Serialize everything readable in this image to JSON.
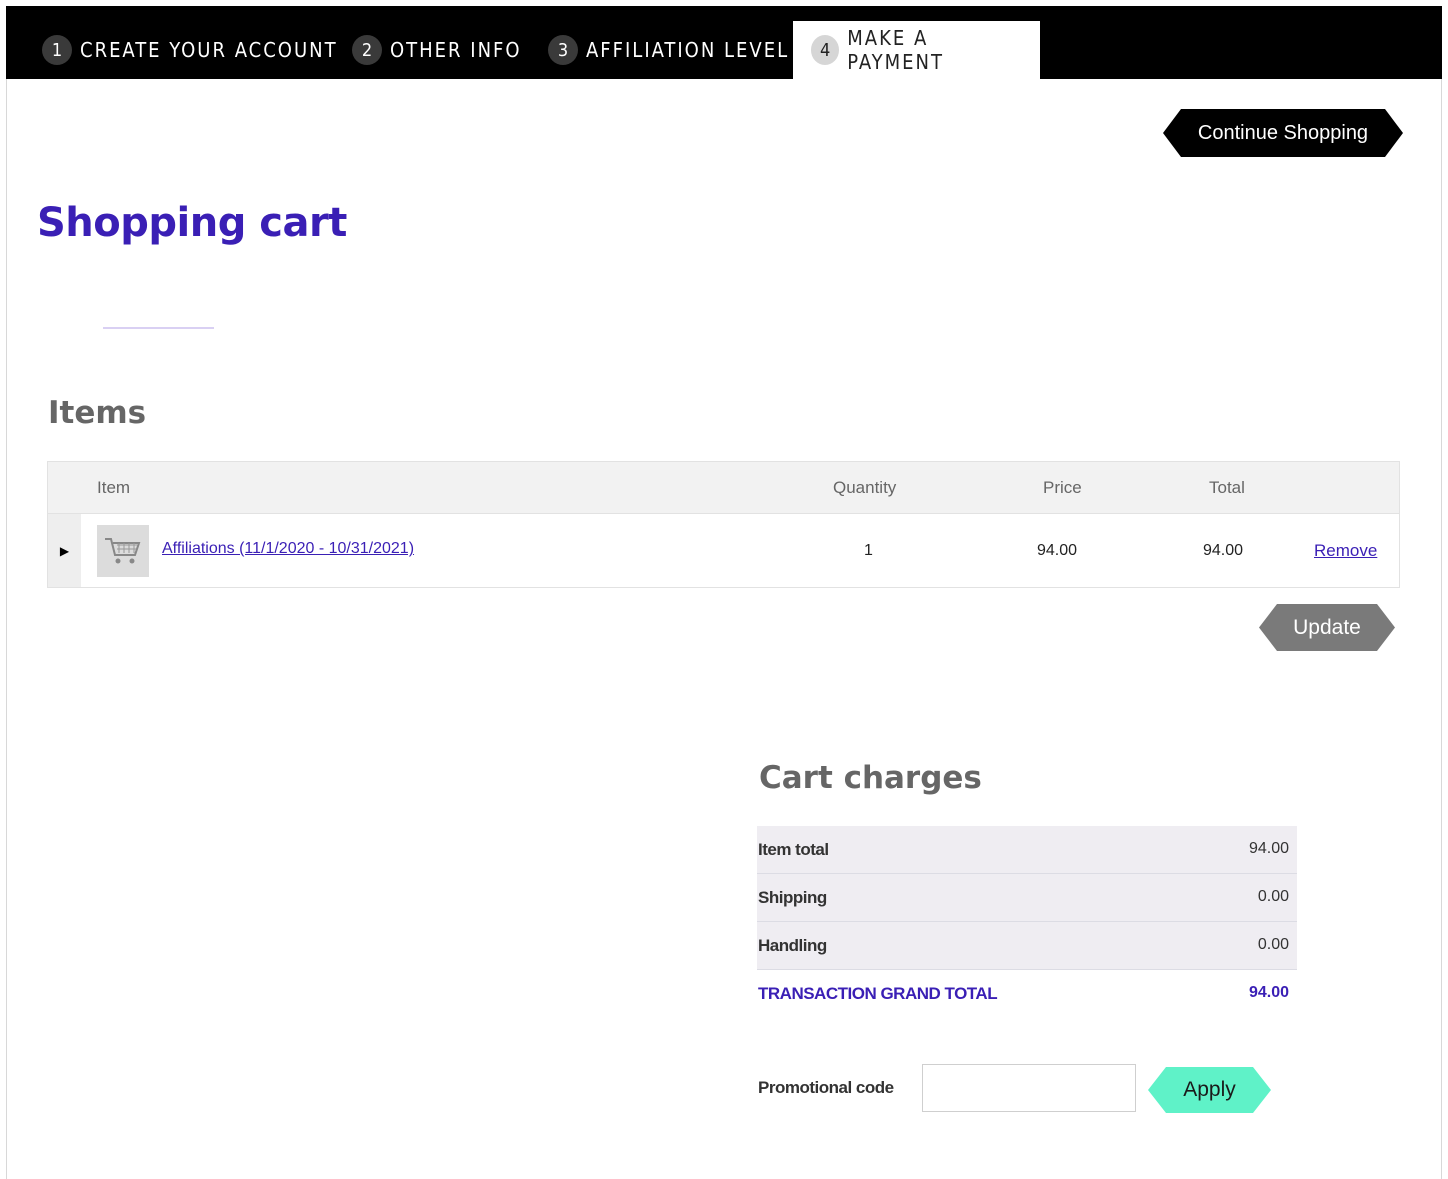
{
  "steps": [
    {
      "num": "1",
      "label": "CREATE YOUR ACCOUNT"
    },
    {
      "num": "2",
      "label": "OTHER INFO"
    },
    {
      "num": "3",
      "label": "AFFILIATION LEVEL"
    },
    {
      "num": "4",
      "label": "MAKE A PAYMENT"
    }
  ],
  "continue_label": "Continue Shopping",
  "page_title": "Shopping cart",
  "items": {
    "title": "Items",
    "headers": {
      "item": "Item",
      "quantity": "Quantity",
      "price": "Price",
      "total": "Total"
    },
    "rows": [
      {
        "name": "Affiliations (11/1/2020 - 10/31/2021)",
        "quantity": "1",
        "price": "94.00",
        "total": "94.00",
        "remove": "Remove"
      }
    ],
    "expander_icon": "triangle-right-icon",
    "thumb_icon": "cart-icon",
    "update_label": "Update"
  },
  "charges": {
    "title": "Cart charges",
    "rows": [
      {
        "label": "Item total",
        "value": "94.00"
      },
      {
        "label": "Shipping",
        "value": "0.00"
      },
      {
        "label": "Handling",
        "value": "0.00"
      }
    ],
    "grand_label": "TRANSACTION GRAND TOTAL",
    "grand_value": "94.00"
  },
  "promo": {
    "label": "Promotional code",
    "value": "",
    "apply_label": "Apply"
  },
  "colors": {
    "accent": "#3a1fb5",
    "apply": "#5ff2c8",
    "update": "#7a7a7a"
  }
}
